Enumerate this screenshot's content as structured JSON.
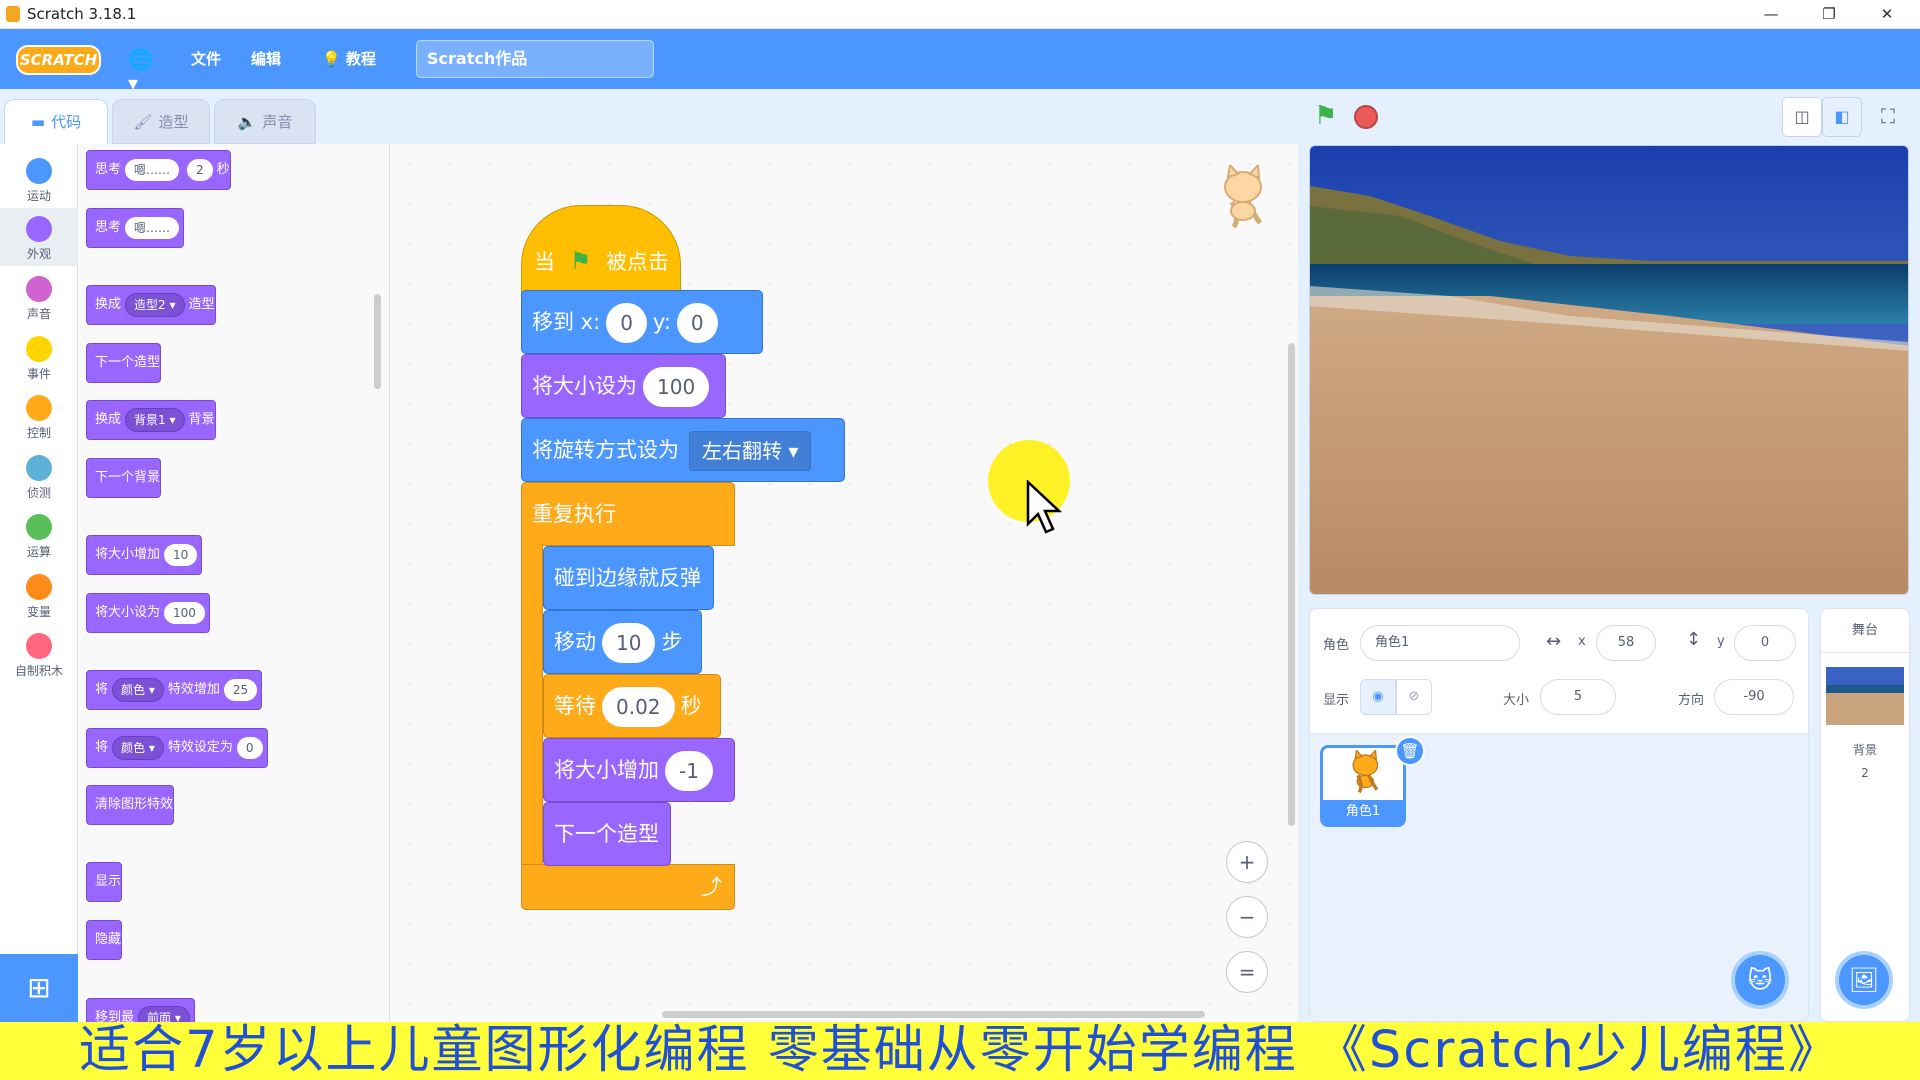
{
  "window": {
    "title": "Scratch 3.18.1",
    "minimize": "—",
    "restore": "❐",
    "close": "✕"
  },
  "menubar": {
    "logo": "SCRATCH",
    "file": "文件",
    "edit": "编辑",
    "tutorials": "教程",
    "project_title": "Scratch作品",
    "globe": "🌐▾"
  },
  "tabs": [
    {
      "label": "代码",
      "icon": "code-icon"
    },
    {
      "label": "造型",
      "icon": "brush-icon"
    },
    {
      "label": "声音",
      "icon": "speaker-icon"
    }
  ],
  "categories": [
    {
      "label": "运动",
      "color": "#4c97ff"
    },
    {
      "label": "外观",
      "color": "#9966ff"
    },
    {
      "label": "声音",
      "color": "#cf63cf"
    },
    {
      "label": "事件",
      "color": "#ffd500"
    },
    {
      "label": "控制",
      "color": "#ffab19"
    },
    {
      "label": "侦测",
      "color": "#5cb1d6"
    },
    {
      "label": "运算",
      "color": "#59c059"
    },
    {
      "label": "变量",
      "color": "#ff8c1a"
    },
    {
      "label": "自制积木",
      "color": "#ff6680"
    }
  ],
  "palette": {
    "think_secs": {
      "a": "思考",
      "v": "嗯……",
      "n": "2",
      "b": "秒"
    },
    "think": {
      "a": "思考",
      "v": "嗯……"
    },
    "switch_costume": {
      "a": "换成",
      "dd": "造型2 ▾",
      "b": "造型"
    },
    "next_costume": "下一个造型",
    "switch_backdrop": {
      "a": "换成",
      "dd": "背景1 ▾",
      "b": "背景"
    },
    "next_backdrop": "下一个背景",
    "change_size": {
      "a": "将大小增加",
      "n": "10"
    },
    "set_size": {
      "a": "将大小设为",
      "n": "100"
    },
    "change_effect": {
      "a": "将",
      "dd": "颜色 ▾",
      "b": "特效增加",
      "n": "25"
    },
    "set_effect": {
      "a": "将",
      "dd": "颜色 ▾",
      "b": "特效设定为",
      "n": "0"
    },
    "clear_effects": "清除图形特效",
    "show": "显示",
    "hide": "隐藏",
    "goto_layer": {
      "a": "移到最",
      "dd": "前面 ▾"
    }
  },
  "script": {
    "hat": {
      "a": "当",
      "b": "被点击"
    },
    "goto": {
      "a": "移到 x:",
      "x": "0",
      "ylab": "y:",
      "y": "0"
    },
    "setsize": {
      "a": "将大小设为",
      "n": "100"
    },
    "rotation": {
      "a": "将旋转方式设为",
      "dd": "左右翻转 ▾"
    },
    "forever": "重复执行",
    "bounce": "碰到边缘就反弹",
    "move": {
      "a": "移动",
      "n": "10",
      "b": "步"
    },
    "wait": {
      "a": "等待",
      "n": "0.02",
      "b": "秒"
    },
    "changesize": {
      "a": "将大小增加",
      "n": "-1"
    },
    "nextcostume": "下一个造型",
    "loop_arrow": "⤴"
  },
  "zoom": {
    "in": "+",
    "out": "−",
    "reset": "="
  },
  "sprite_info": {
    "sprite_label": "角色",
    "sprite_name": "角色1",
    "x_label": "x",
    "x": "58",
    "y_label": "y",
    "y": "0",
    "show_label": "显示",
    "size_label": "大小",
    "size": "5",
    "direction_label": "方向",
    "direction": "-90"
  },
  "sprite_list": [
    {
      "name": "角色1"
    }
  ],
  "stage_selector": {
    "title": "舞台",
    "backdrops_label": "背景",
    "backdrops_count": "2"
  },
  "banner": "适合7岁以上儿童图形化编程  零基础从零开始学编程 《Scratch少儿编程》"
}
